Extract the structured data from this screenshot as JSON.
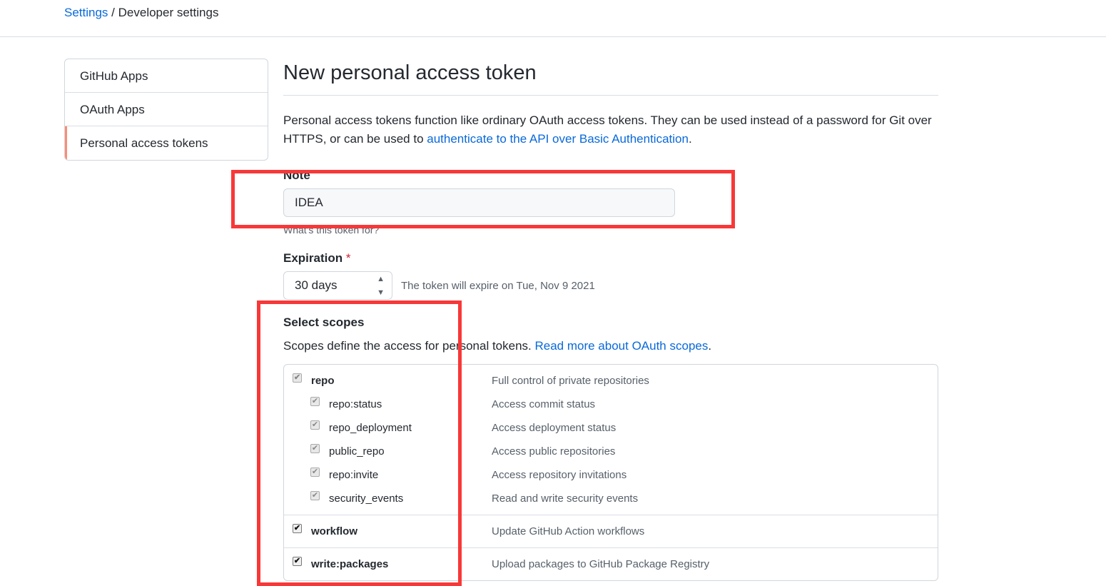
{
  "breadcrumb": {
    "settings": "Settings",
    "sep": "/",
    "current": "Developer settings"
  },
  "sidebar": {
    "items": [
      {
        "label": "GitHub Apps"
      },
      {
        "label": "OAuth Apps"
      },
      {
        "label": "Personal access tokens",
        "active": true
      }
    ]
  },
  "page": {
    "title": "New personal access token",
    "desc_pre": "Personal access tokens function like ordinary OAuth access tokens. They can be used instead of a password for Git over HTTPS, or can be used to ",
    "desc_link": "authenticate to the API over Basic Authentication",
    "desc_post": "."
  },
  "note": {
    "label": "Note",
    "value": "IDEA",
    "help": "What's this token for?"
  },
  "expiration": {
    "label": "Expiration",
    "required": "*",
    "selected": "30 days",
    "info": "The token will expire on Tue, Nov 9 2021"
  },
  "scopes": {
    "label": "Select scopes",
    "desc_pre": "Scopes define the access for personal tokens. ",
    "desc_link": "Read more about OAuth scopes",
    "groups": [
      {
        "name": "repo",
        "desc": "Full control of private repositories",
        "checked": true,
        "disabled": true,
        "children": [
          {
            "name": "repo:status",
            "desc": "Access commit status"
          },
          {
            "name": "repo_deployment",
            "desc": "Access deployment status"
          },
          {
            "name": "public_repo",
            "desc": "Access public repositories"
          },
          {
            "name": "repo:invite",
            "desc": "Access repository invitations"
          },
          {
            "name": "security_events",
            "desc": "Read and write security events"
          }
        ]
      },
      {
        "name": "workflow",
        "desc": "Update GitHub Action workflows",
        "checked": true
      },
      {
        "name": "write:packages",
        "desc": "Upload packages to GitHub Package Registry",
        "checked": true
      }
    ]
  },
  "annotation_color": "#f83838"
}
